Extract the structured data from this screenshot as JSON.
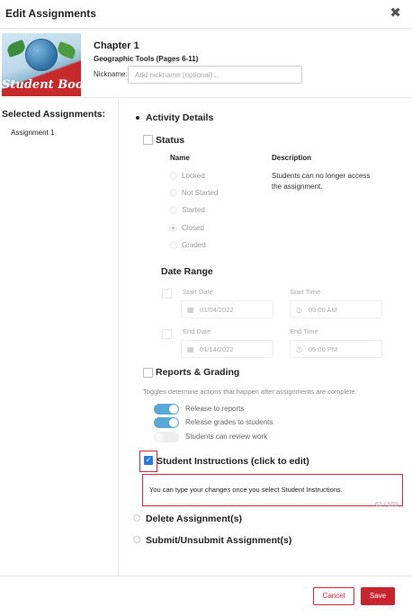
{
  "header": {
    "title": "Edit Assignments",
    "close_icon": "✖"
  },
  "book": {
    "cover_text": "Student Book",
    "chapter": "Chapter 1",
    "subtitle": "Geographic Tools (Pages 6-11)",
    "nickname_label": "Nickname:",
    "nickname_placeholder": "Add nickname (optional)...",
    "nickname_value": ""
  },
  "sidebar": {
    "title": "Selected Assignments:",
    "items": [
      "Assignment 1"
    ]
  },
  "activity_details": {
    "label": "Activity Details",
    "status": {
      "label": "Status",
      "name_header": "Name",
      "description_header": "Description",
      "options": [
        "Locked",
        "Not Started",
        "Started",
        "Closed",
        "Graded"
      ],
      "selected": "Closed",
      "description": "Students can no longer access the assignment."
    },
    "date_range": {
      "label": "Date Range",
      "start_date_label": "Start Date",
      "start_date": "01/04/2022",
      "start_time_label": "Start Time",
      "start_time": "09:00 AM",
      "end_date_label": "End Date",
      "end_date": "01/14/2022",
      "end_time_label": "End Time",
      "end_time": "05:00 PM"
    },
    "reports_grading": {
      "label": "Reports & Grading",
      "hint": "Toggles determine actions that happen after assignments are complete.",
      "toggles": [
        {
          "label": "Release to reports",
          "on": true
        },
        {
          "label": "Release grades to students",
          "on": true
        },
        {
          "label": "Students can review work",
          "on": false
        }
      ]
    },
    "student_instructions": {
      "label": "Student Instructions (click to edit)",
      "checked": true,
      "text": "You can type your changes once you select Student Instructions.",
      "counter": "63 / 500"
    }
  },
  "sections": {
    "delete": "Delete Assignment(s)",
    "submit": "Submit/Unsubmit Assignment(s)"
  },
  "footer": {
    "cancel_label": "Cancel",
    "save_label": "Save"
  },
  "colors": {
    "accent_red": "#d8283a",
    "toggle_blue": "#5aa8d8",
    "check_blue": "#2b7bd9"
  }
}
